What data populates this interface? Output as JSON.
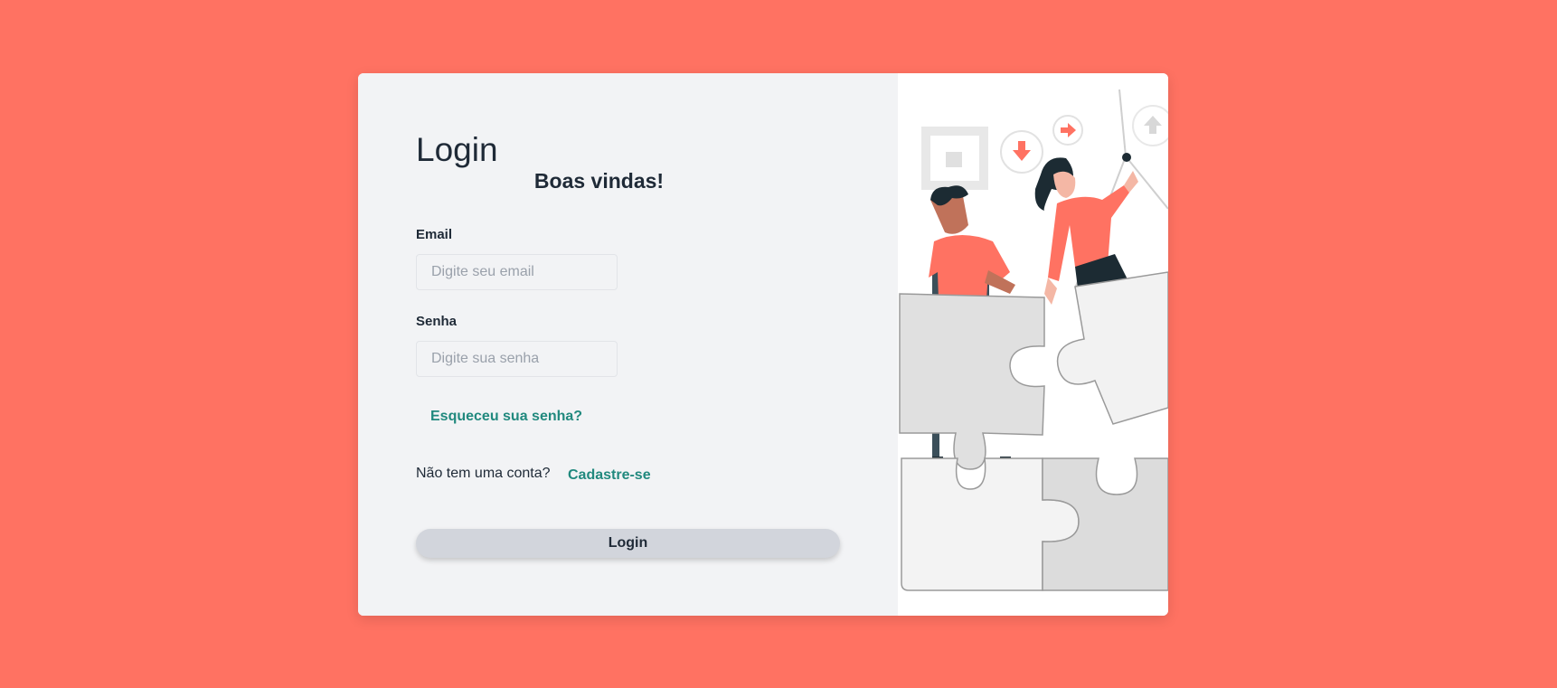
{
  "login_form": {
    "title": "Login",
    "subtitle": "Boas vindas!",
    "email_label": "Email",
    "email_placeholder": "Digite seu email",
    "email_value": "",
    "password_label": "Senha",
    "password_placeholder": "Digite sua senha",
    "password_value": "",
    "forgot_password_link": "Esqueceu sua senha?",
    "no_account_text": "Não tem uma conta?",
    "signup_link": "Cadastre-se",
    "submit_label": "Login"
  },
  "colors": {
    "page_background": "#ff7262",
    "card_background": "#f2f3f5",
    "link": "#21897e",
    "text": "#1f2a37",
    "button": "#d2d5dc"
  },
  "illustration": {
    "subject": "two people assembling puzzle pieces",
    "icons": [
      "arrow-down-bubble-icon",
      "arrow-right-bubble-icon",
      "arrow-up-bubble-icon",
      "square-frame-icon"
    ]
  }
}
